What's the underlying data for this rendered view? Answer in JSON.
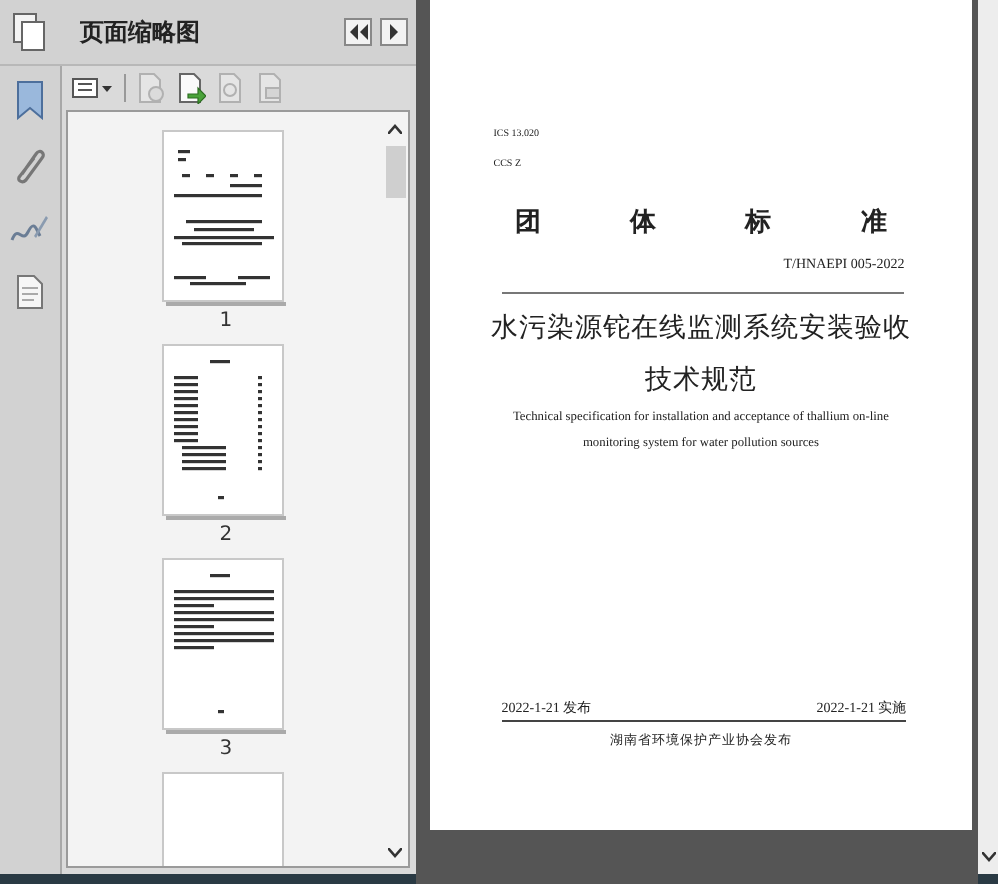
{
  "panel": {
    "title": "页面缩略图"
  },
  "side_tabs": [
    {
      "kind": "bookmark"
    },
    {
      "kind": "attachment"
    },
    {
      "kind": "signature"
    },
    {
      "kind": "page"
    }
  ],
  "toolbar": [
    {
      "kind": "options",
      "disabled": false
    },
    {
      "kind": "delete",
      "disabled": true
    },
    {
      "kind": "insert",
      "disabled": false
    },
    {
      "kind": "zoom",
      "disabled": true
    },
    {
      "kind": "print",
      "disabled": true
    }
  ],
  "thumbnails": [
    {
      "kind": "cover",
      "label": "1"
    },
    {
      "kind": "contents",
      "label": "2"
    },
    {
      "kind": "text",
      "label": "3"
    },
    {
      "kind": "blank"
    }
  ],
  "document": {
    "ics": "ICS 13.020",
    "ccs": "CCS Z",
    "heading": "团 体 标 准",
    "number": "T/HNAEPI 005-2022",
    "title_lines": [
      "水污染源铊在线监测系统安装验收",
      "技术规范"
    ],
    "english_lines": [
      "Technical specification for installation and acceptance of thallium on-line",
      "monitoring system for water pollution sources"
    ],
    "issued": "2022-1-21 发布",
    "effective": "2022-1-21 实施",
    "publisher": "湖南省环境保护产业协会发布"
  }
}
